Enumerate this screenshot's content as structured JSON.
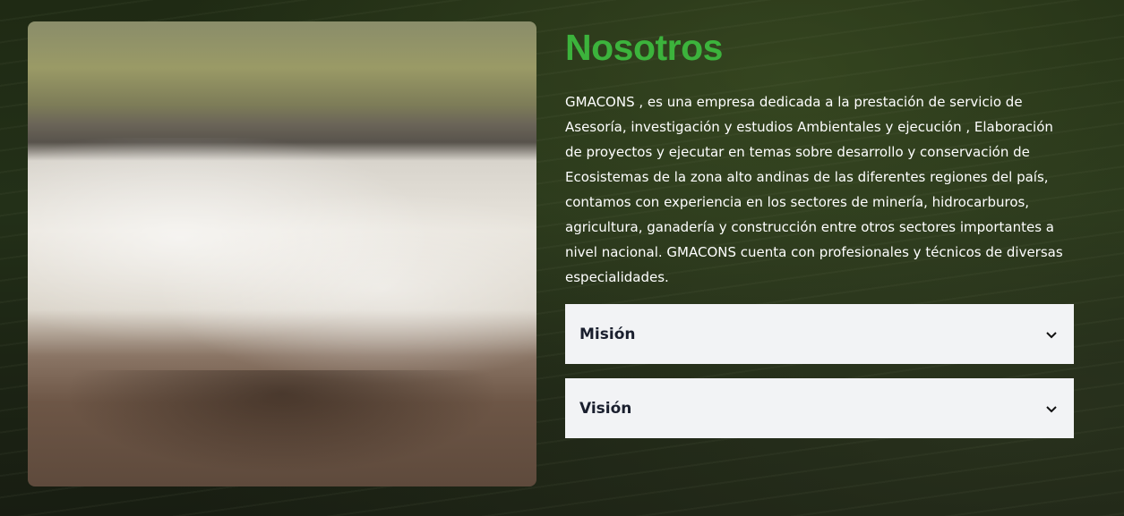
{
  "section": {
    "title": "Nosotros",
    "description": "GMACONS , es una empresa dedicada a la prestación de servicio de Asesoría, investigación y estudios Ambientales y ejecución , Elaboración de proyectos y ejecutar en temas sobre desarrollo y conservación de Ecosistemas de la zona alto andinas de las diferentes regiones del país, contamos con experiencia en los sectores de minería, hidrocarburos, agricultura, ganadería y construcción entre otros sectores importantes a nivel nacional. GMACONS cuenta con profesionales y técnicos de diversas especialidades."
  },
  "accordion": [
    {
      "label": "Misión",
      "icon": "chevron-down-icon"
    },
    {
      "label": "Visión",
      "icon": "chevron-down-icon"
    }
  ],
  "colors": {
    "title": "#3cb33c",
    "accordion_bg": "#f2f3f5"
  }
}
